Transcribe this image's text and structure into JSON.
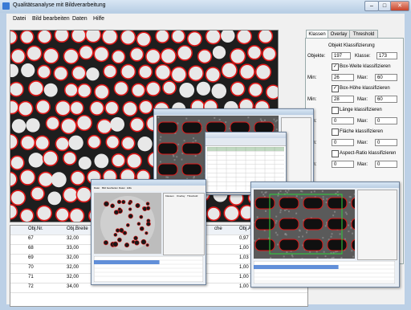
{
  "window": {
    "title": "Qualitätsanalyse mit Bildverarbeitung",
    "minimize": "–",
    "maximize": "□",
    "close": "✕",
    "app_icon": "app-icon"
  },
  "menu": [
    "Datei",
    "Bild bearbeiten",
    "Daten",
    "Hilfe"
  ],
  "grid": {
    "columns": [
      "Obj.Nr.",
      "Obj.Breite",
      "che",
      "Obj.Aspec"
    ],
    "rows": [
      [
        "67",
        "32,00",
        "",
        "0,97"
      ],
      [
        "68",
        "33,00",
        "",
        "1,00"
      ],
      [
        "69",
        "32,00",
        "",
        "1,03"
      ],
      [
        "70",
        "32,00",
        "",
        "1,00"
      ],
      [
        "71",
        "32,00",
        "",
        "1,00"
      ],
      [
        "72",
        "34,00",
        "",
        "1,00"
      ]
    ]
  },
  "tabs": {
    "items": [
      "Klassen",
      "Overlay",
      "Threshold"
    ],
    "active": 0
  },
  "klassen": {
    "heading": "Objekt Klassifizierung",
    "objekte_label": "Objekte:",
    "objekte_value": "197",
    "klasse_label": "Klasse:",
    "klasse_value": "173",
    "box_weite": {
      "label": "Box-Weite klassifizieren",
      "checked": true,
      "min_label": "Min:",
      "min": "26",
      "max_label": "Max:",
      "max": "60"
    },
    "box_hoehe": {
      "label": "Box-Höhe klassifizieren",
      "checked": true,
      "min_label": "Min:",
      "min": "28",
      "max_label": "Max:",
      "max": "60"
    },
    "laenge": {
      "label": "Länge klassifizieren",
      "checked": false,
      "min_label": "Min:",
      "min": "0",
      "max_label": "Max:",
      "max": "0"
    },
    "flaeche": {
      "label": "Fläche klassifizieren",
      "checked": false,
      "min_label": "Min:",
      "min": "0",
      "max_label": "Max:",
      "max": "0"
    },
    "aspect": {
      "label": "Aspect-Ratio klassifizieren",
      "checked": false,
      "min_label": "Min:",
      "min": "0",
      "max_label": "Max:",
      "max": "0"
    }
  },
  "overlay_small": {
    "menu": [
      "Datei",
      "Bild bearbeiten",
      "Daten",
      "Hilfe"
    ],
    "tabs": [
      "Klassen",
      "Overlay",
      "Threshold"
    ]
  },
  "colors": {
    "accent_red": "#e01818",
    "window_blue": "#bcd0e6",
    "excel_green": "#2f7d32"
  }
}
